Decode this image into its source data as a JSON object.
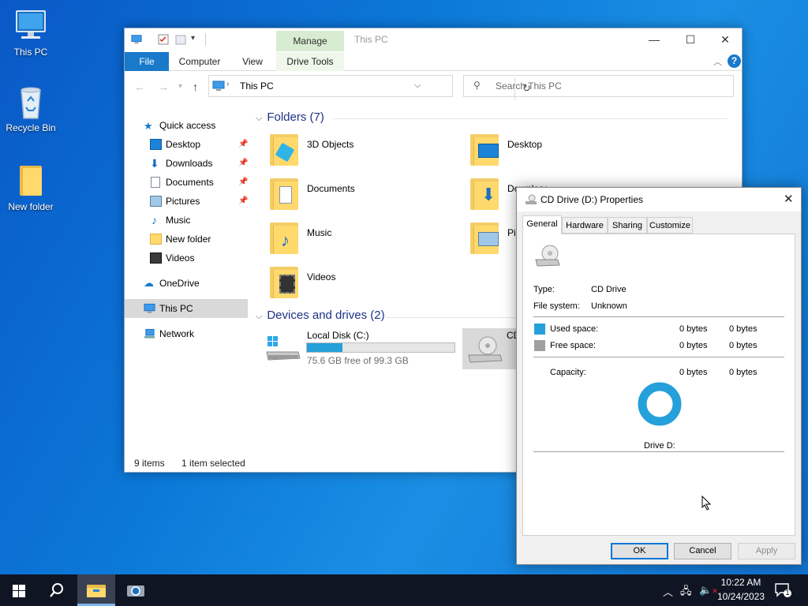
{
  "desktop": {
    "icons": [
      {
        "label": "This PC"
      },
      {
        "label": "Recycle Bin"
      },
      {
        "label": "New folder"
      }
    ]
  },
  "explorer": {
    "title": "This PC",
    "context_tab": "Manage",
    "tabs": [
      "File",
      "Computer",
      "View",
      "Drive Tools"
    ],
    "address": "This PC",
    "search_placeholder": "Search This PC",
    "nav": {
      "quick_access": "Quick access",
      "quick_items": [
        "Desktop",
        "Downloads",
        "Documents",
        "Pictures",
        "Music",
        "New folder",
        "Videos"
      ],
      "onedrive": "OneDrive",
      "this_pc": "This PC",
      "network": "Network"
    },
    "folders_header": "Folders (7)",
    "folders": [
      "3D Objects",
      "Desktop",
      "Documents",
      "Downloads",
      "Music",
      "Pictures",
      "Videos"
    ],
    "drives_header": "Devices and drives (2)",
    "drives": [
      {
        "name": "Local Disk (C:)",
        "free_text": "75.6 GB free of 99.3 GB",
        "used_fraction": 0.24
      },
      {
        "name": "CD"
      }
    ],
    "status": {
      "items": "9 items",
      "selected": "1 item selected"
    }
  },
  "properties": {
    "title": "CD Drive (D:) Properties",
    "tabs": [
      "General",
      "Hardware",
      "Sharing",
      "Customize"
    ],
    "type_label": "Type:",
    "type_value": "CD Drive",
    "fs_label": "File system:",
    "fs_value": "Unknown",
    "used_label": "Used space:",
    "used_bytes": "0 bytes",
    "used_size": "0 bytes",
    "free_label": "Free space:",
    "free_bytes": "0 bytes",
    "free_size": "0 bytes",
    "capacity_label": "Capacity:",
    "capacity_bytes": "0 bytes",
    "capacity_size": "0 bytes",
    "drive_label": "Drive D:",
    "buttons": {
      "ok": "OK",
      "cancel": "Cancel",
      "apply": "Apply"
    },
    "colors": {
      "used": "#26a0da",
      "free": "#a0a0a0",
      "ring": "#26a0da"
    }
  },
  "taskbar": {
    "time": "10:22 AM",
    "date": "10/24/2023",
    "notification_count": "1"
  }
}
